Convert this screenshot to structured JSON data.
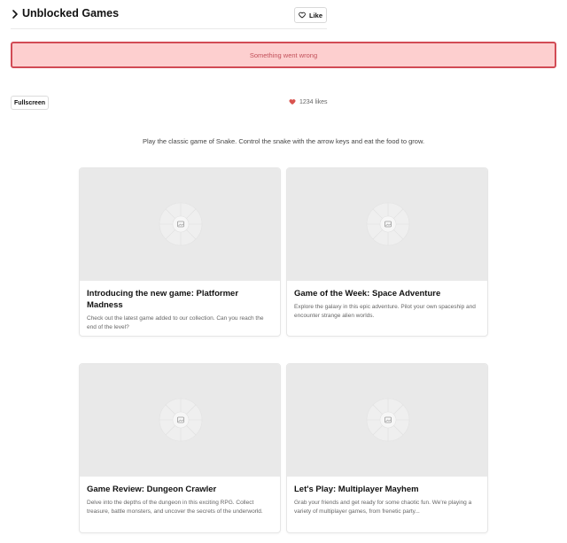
{
  "header": {
    "title": "Unblocked Games",
    "like_label": "Like"
  },
  "error": {
    "message": "Something went wrong"
  },
  "toolbar": {
    "fullscreen_label": "Fullscreen",
    "likes_text": "1234 likes"
  },
  "game": {
    "description": "Play the classic game of Snake. Control the snake with the arrow keys and eat the food to grow."
  },
  "posts": [
    {
      "title": "Introducing the new game: Platformer Madness",
      "description": "Check out the latest game added to our collection. Can you reach the end of the level?"
    },
    {
      "title": "Game of the Week: Space Adventure",
      "description": "Explore the galaxy in this epic adventure. Pilot your own spaceship and encounter strange alien worlds."
    },
    {
      "title": "Game Review: Dungeon Crawler",
      "description": "Delve into the depths of the dungeon in this exciting RPG. Collect treasure, battle monsters, and uncover the secrets of the underworld."
    },
    {
      "title": "Let's Play: Multiplayer Mayhem",
      "description": "Grab your friends and get ready for some chaotic fun. We're playing a variety of multiplayer games, from frenetic party..."
    }
  ],
  "colors": {
    "error_bg": "#fdcfcf",
    "error_border": "#d24b55",
    "error_text": "#c2505a",
    "heart": "#d9534f"
  },
  "icons": {
    "expand": "chevron-right-icon",
    "like": "heart-outline-icon",
    "likes": "heart-filled-icon",
    "image": "image-placeholder-icon"
  }
}
